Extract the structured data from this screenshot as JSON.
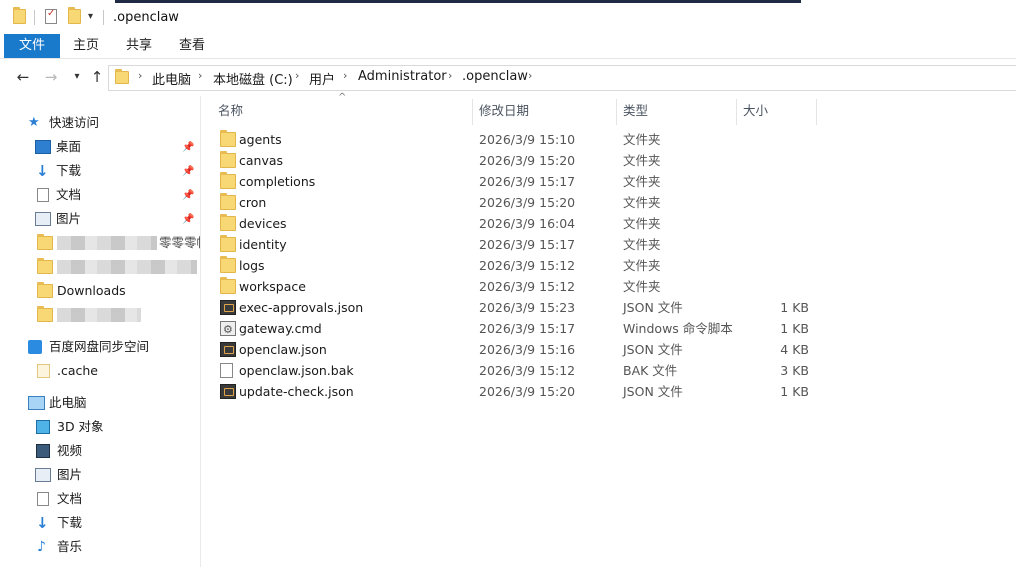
{
  "window": {
    "title": ".openclaw"
  },
  "ribbon": {
    "tabs": [
      "文件",
      "主页",
      "共享",
      "查看"
    ]
  },
  "address": {
    "breadcrumbs": [
      "此电脑",
      "本地磁盘 (C:)",
      "用户",
      "Administrator",
      ".openclaw"
    ]
  },
  "sidebar": {
    "quick_access": "快速访问",
    "pinned": [
      "桌面",
      "下载",
      "文档",
      "图片"
    ],
    "blurred_partial": "零零零帆",
    "downloads": "Downloads",
    "baidu": "百度网盘同步空间",
    "cache": ".cache",
    "this_pc": "此电脑",
    "pc_items": [
      "3D 对象",
      "视频",
      "图片",
      "文档",
      "下载",
      "音乐"
    ]
  },
  "columns": {
    "name": "名称",
    "date": "修改日期",
    "type": "类型",
    "size": "大小"
  },
  "files": [
    {
      "name": "agents",
      "date": "2026/3/9 15:10",
      "type": "文件夹",
      "size": "",
      "icon": "folder-icon"
    },
    {
      "name": "canvas",
      "date": "2026/3/9 15:20",
      "type": "文件夹",
      "size": "",
      "icon": "folder-icon"
    },
    {
      "name": "completions",
      "date": "2026/3/9 15:17",
      "type": "文件夹",
      "size": "",
      "icon": "folder-icon"
    },
    {
      "name": "cron",
      "date": "2026/3/9 15:20",
      "type": "文件夹",
      "size": "",
      "icon": "folder-icon"
    },
    {
      "name": "devices",
      "date": "2026/3/9 16:04",
      "type": "文件夹",
      "size": "",
      "icon": "folder-icon"
    },
    {
      "name": "identity",
      "date": "2026/3/9 15:17",
      "type": "文件夹",
      "size": "",
      "icon": "folder-icon"
    },
    {
      "name": "logs",
      "date": "2026/3/9 15:12",
      "type": "文件夹",
      "size": "",
      "icon": "folder-icon"
    },
    {
      "name": "workspace",
      "date": "2026/3/9 15:12",
      "type": "文件夹",
      "size": "",
      "icon": "folder-icon"
    },
    {
      "name": "exec-approvals.json",
      "date": "2026/3/9 15:23",
      "type": "JSON 文件",
      "size": "1 KB",
      "icon": "json-file-icon"
    },
    {
      "name": "gateway.cmd",
      "date": "2026/3/9 15:17",
      "type": "Windows 命令脚本",
      "size": "1 KB",
      "icon": "cmd-file-icon"
    },
    {
      "name": "openclaw.json",
      "date": "2026/3/9 15:16",
      "type": "JSON 文件",
      "size": "4 KB",
      "icon": "json-file-icon"
    },
    {
      "name": "openclaw.json.bak",
      "date": "2026/3/9 15:12",
      "type": "BAK 文件",
      "size": "3 KB",
      "icon": "blank-file-icon"
    },
    {
      "name": "update-check.json",
      "date": "2026/3/9 15:20",
      "type": "JSON 文件",
      "size": "1 KB",
      "icon": "json-file-icon"
    }
  ],
  "colors": {
    "file_tab": "#1979ca",
    "folder": "#f8d775"
  }
}
